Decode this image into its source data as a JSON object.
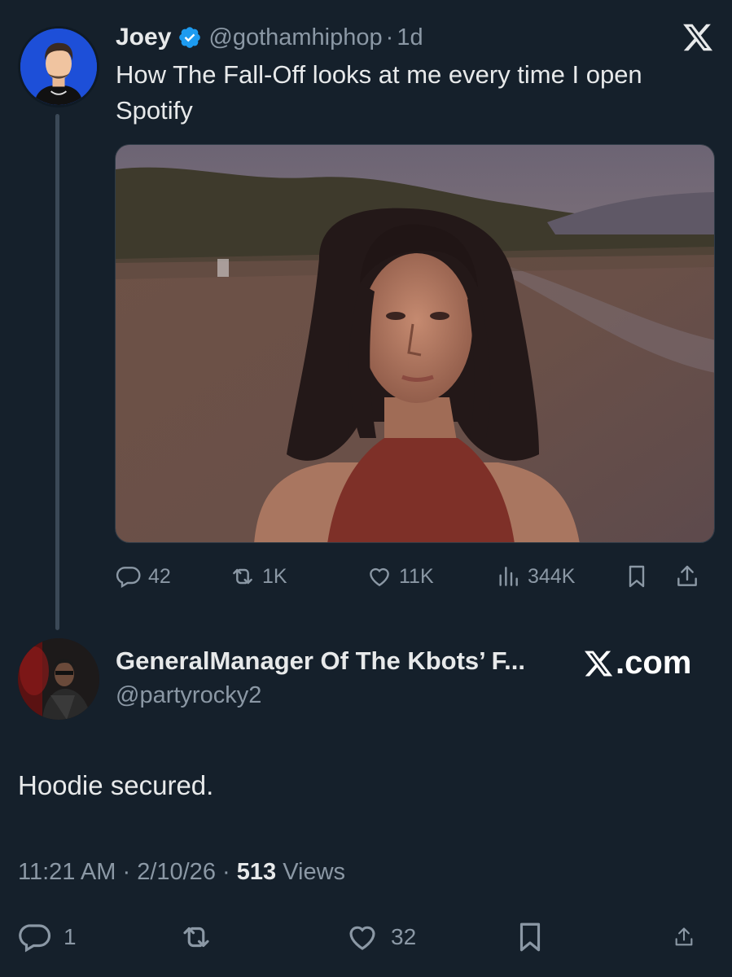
{
  "parent_tweet": {
    "author_name": "Joey",
    "verified": true,
    "handle": "@gothamhiphop",
    "separator": "·",
    "age": "1d",
    "text": "How The Fall-Off looks at me every time I open Spotify",
    "stats": {
      "replies": "42",
      "reposts": "1K",
      "likes": "11K",
      "views": "344K"
    }
  },
  "reply_tweet": {
    "author_name": "GeneralManager Of The Kbots’ F...",
    "handle": "@partyrocky2",
    "source_badge": ".com",
    "text": "Hoodie secured.",
    "time": "11:21 AM",
    "dot1": "·",
    "date": "2/10/26",
    "dot2": "·",
    "views_count": "513",
    "views_label": "Views",
    "stats": {
      "replies": "1",
      "likes": "32"
    }
  },
  "colors": {
    "background": "#15202b",
    "primary_text": "#e7e9ea",
    "secondary_text": "#8b98a5",
    "verified_blue": "#1d9bf0"
  },
  "icons": {
    "x_logo": "x-logo-icon",
    "verified": "verified-badge-icon",
    "reply": "reply-icon",
    "repost": "repost-icon",
    "like": "heart-icon",
    "views": "views-chart-icon",
    "bookmark": "bookmark-icon",
    "share": "share-icon"
  }
}
